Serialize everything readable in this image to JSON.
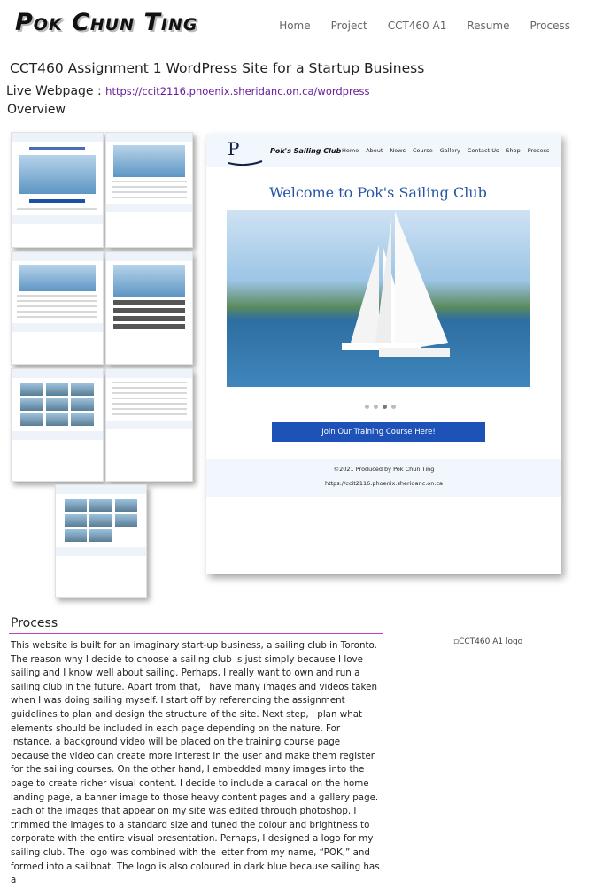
{
  "site": {
    "logo": "Pok Chun Ting"
  },
  "nav": [
    "Home",
    "Project",
    "CCT460 A1",
    "Resume",
    "Process"
  ],
  "page_heading": "CCT460 Assignment 1 WordPress Site for a Startup Business",
  "live": {
    "label": "Live Webpage :",
    "url": "https://ccit2116.phoenix.sheridanc.on.ca/wordpress"
  },
  "overview_title": "Overview",
  "preview": {
    "logo_letter": "P",
    "club_name": "Pok's Sailing Club",
    "nav": [
      "Home",
      "About",
      "News",
      "Course",
      "Gallery",
      "Contact Us",
      "Shop",
      "Process"
    ],
    "welcome": "Welcome to Pok's Sailing Club",
    "button": "Join Our Training Course Here!",
    "footer_credit": "©2021 Produced by Pok Chun Ting",
    "footer_url": "https://ccit2116.phoenix.sheridanc.on.ca",
    "slide_dots_active_index": 2
  },
  "process_title": "Process",
  "process_body": "This website is built for an imaginary start-up business, a sailing club in Toronto. The reason why I decide to choose a sailing club is just simply because I love sailing and I know well about sailing. Perhaps, I really want to own and run a sailing club in the future. Apart from that, I have many images and videos taken when I was doing sailing myself. I start off by referencing the assignment guidelines to plan and design the structure of the site. Next step, I plan what elements should be included in each page depending on the nature. For instance, a background video will be placed on the training course page because the video can create more interest in the user and make them register for the sailing courses. On the other hand, I embedded many images into the page to create richer visual content. I decide to include a caracal on the home landing page, a banner image to those heavy content pages and a gallery page. Each of the images that appear on my site was edited through photoshop. I trimmed the images to a standard size and tuned the colour and brightness to corporate with the entire visual presentation. Perhaps, I designed a logo for my sailing club. The logo was combined with the letter from my name, “POK,” and formed into a sailboat. The logo is also coloured in dark blue because sailing has a",
  "logo_alt": "CCT460 A1 logo"
}
